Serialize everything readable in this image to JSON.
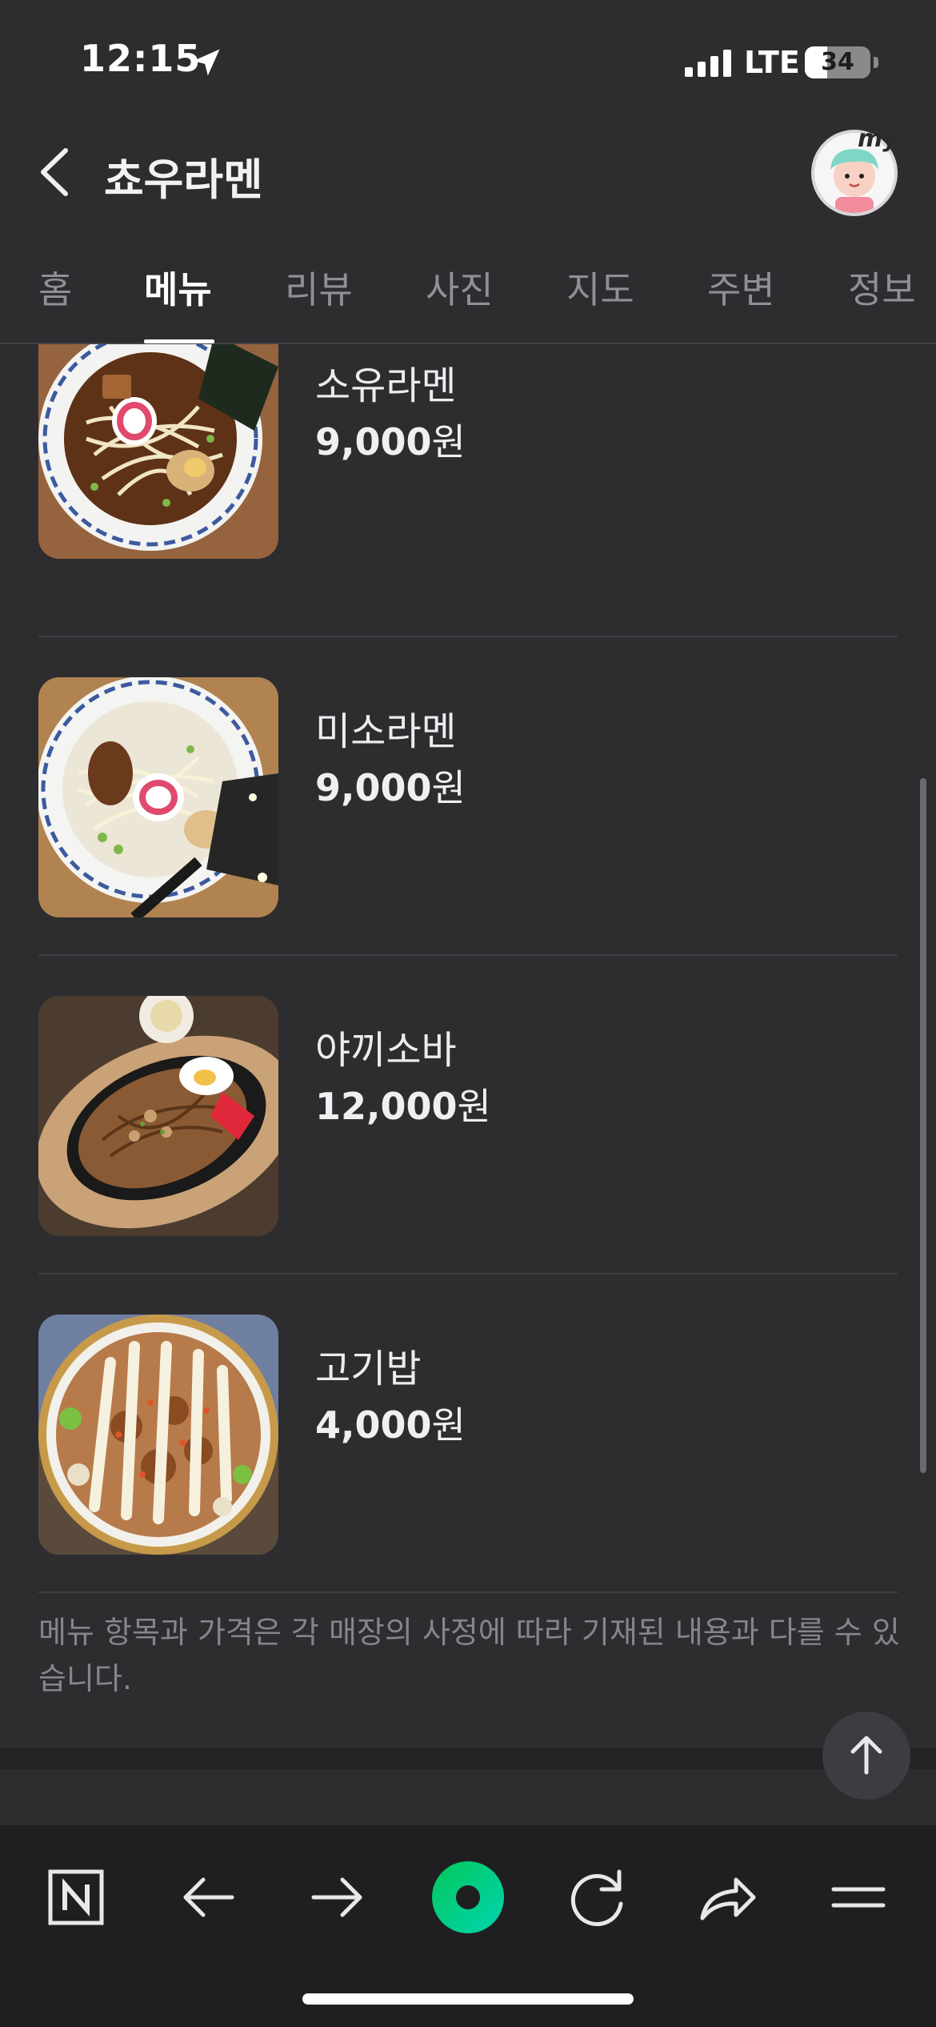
{
  "status_bar": {
    "time": "12:15",
    "network": "LTE",
    "battery_percent": "34",
    "battery_level": 0.34
  },
  "header": {
    "title": "쵸우라멘",
    "avatar_badge": "my"
  },
  "tabs": [
    {
      "label": "홈",
      "active": false
    },
    {
      "label": "메뉴",
      "active": true
    },
    {
      "label": "리뷰",
      "active": false
    },
    {
      "label": "사진",
      "active": false
    },
    {
      "label": "지도",
      "active": false
    },
    {
      "label": "주변",
      "active": false
    },
    {
      "label": "정보",
      "active": false
    }
  ],
  "menu": [
    {
      "name": "소유라멘",
      "price": "9,000",
      "unit": "원"
    },
    {
      "name": "미소라멘",
      "price": "9,000",
      "unit": "원"
    },
    {
      "name": "야끼소바",
      "price": "12,000",
      "unit": "원"
    },
    {
      "name": "고기밥",
      "price": "4,000",
      "unit": "원"
    }
  ],
  "notice": "메뉴 항목과 가격은 각 매장의 사정에 따라 기재된 내용과 다를 수 있습니다.",
  "toolbar": {
    "icons": [
      "naver-n-icon",
      "arrow-left-icon",
      "arrow-right-icon",
      "green-dot-icon",
      "refresh-icon",
      "share-icon",
      "menu-icon"
    ]
  },
  "colors": {
    "background": "#2d2d30",
    "toolbar": "#1f1f22",
    "accent_green": "#03c75a",
    "accent_teal": "#00d4b0"
  }
}
